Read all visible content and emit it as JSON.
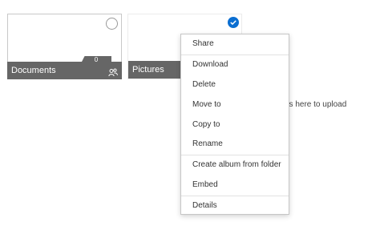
{
  "folders": [
    {
      "name": "Documents",
      "item_count": "0",
      "selected": false,
      "shared": true
    },
    {
      "name": "Pictures",
      "selected": true
    }
  ],
  "upload_hint": "es here to upload",
  "context_menu": {
    "items": [
      {
        "label": "Share"
      },
      {
        "label": "Download"
      },
      {
        "label": "Delete"
      },
      {
        "label": "Move to"
      },
      {
        "label": "Copy to"
      },
      {
        "label": "Rename"
      },
      {
        "label": "Create album from folder"
      },
      {
        "label": "Embed"
      },
      {
        "label": "Details"
      }
    ]
  },
  "colors": {
    "tile_footer": "#666666",
    "selected_check": "#0a6ed1",
    "menu_border": "#c6c6c6"
  },
  "icons": {
    "select": "circle-outline-icon",
    "selected": "checkmark-circle-icon",
    "shared": "people-icon"
  }
}
